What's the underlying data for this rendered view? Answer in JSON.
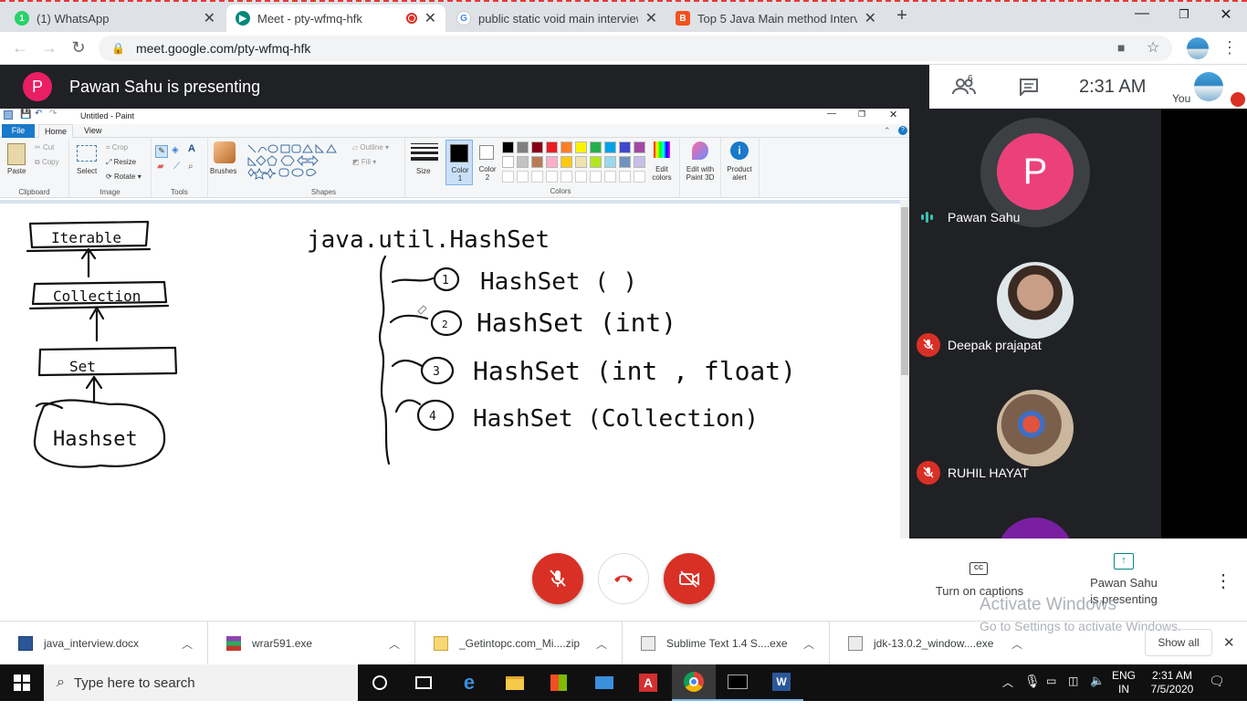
{
  "browser": {
    "tabs": [
      {
        "title": "(1) WhatsApp",
        "favicon": "whatsapp-icon",
        "color": "#25d366"
      },
      {
        "title": "Meet - pty-wfmq-hfk",
        "favicon": "meet-icon",
        "color": "#00897b"
      },
      {
        "title": "public static void main interview",
        "favicon": "google-icon",
        "color": "#4285f4"
      },
      {
        "title": "Top 5 Java Main method Intervie",
        "favicon": "blogger-icon",
        "color": "#f4511e"
      }
    ],
    "new_tab": "+",
    "url": "meet.google.com/pty-wfmq-hfk"
  },
  "meet": {
    "presenter_initial": "P",
    "presenting_banner": "Pawan Sahu is presenting",
    "participant_count": "6",
    "time": "2:31  AM",
    "you_label": "You",
    "participants": [
      {
        "name": "Pawan Sahu",
        "initial": "P",
        "avatar_color": "#ec407a",
        "speaking": true
      },
      {
        "name": "Deepak prajapat",
        "muted": true
      },
      {
        "name": "RUHIL HAYAT",
        "muted": true
      }
    ],
    "captions_label": "Turn on captions",
    "presenting_label_1": "Pawan Sahu",
    "presenting_label_2": "is presenting",
    "watermark_title": "Activate Windows",
    "watermark_sub": "Go to Settings to activate Windows."
  },
  "paint": {
    "title": "Untitled - Paint",
    "tabs": {
      "file": "File",
      "home": "Home",
      "view": "View"
    },
    "groups": {
      "clipboard": "Clipboard",
      "image": "Image",
      "tools": "Tools",
      "shapes": "Shapes",
      "colors": "Colors"
    },
    "buttons": {
      "paste": "Paste",
      "cut": "Cut",
      "copy": "Copy",
      "select": "Select",
      "crop": "Crop",
      "resize": "Resize",
      "rotate": "Rotate",
      "brushes": "Brushes",
      "outline": "Outline",
      "fill": "Fill",
      "size": "Size",
      "color1_a": "Color",
      "color1_b": "1",
      "color2_a": "Color",
      "color2_b": "2",
      "edit_colors_a": "Edit",
      "edit_colors_b": "colors",
      "paint3d_a": "Edit with",
      "paint3d_b": "Paint 3D",
      "product_a": "Product",
      "product_b": "alert"
    },
    "palette_row1": [
      "#000000",
      "#7f7f7f",
      "#880015",
      "#ed1c24",
      "#ff7f27",
      "#fff200",
      "#22b14c",
      "#00a2e8",
      "#3f48cc",
      "#a349a4"
    ],
    "palette_row2": [
      "#ffffff",
      "#c3c3c3",
      "#b97a57",
      "#ffaec9",
      "#ffc90e",
      "#efe4b0",
      "#b5e61d",
      "#99d9ea",
      "#7092be",
      "#c8bfe7"
    ],
    "drawing": {
      "hier": [
        "Iterable",
        "Collection",
        "Set",
        "Hashset"
      ],
      "heading": "java.util.HashSet",
      "constructors": [
        {
          "num": "1",
          "sig": "HashSet ( )"
        },
        {
          "num": "2",
          "sig": "HashSet (int)"
        },
        {
          "num": "3",
          "sig": "HashSet (int , float)"
        },
        {
          "num": "4",
          "sig": "HashSet (Collection)"
        }
      ]
    }
  },
  "downloads": [
    {
      "name": "java_interview.docx",
      "icon": "word-doc-icon"
    },
    {
      "name": "wrar591.exe",
      "icon": "winrar-icon"
    },
    {
      "name": "_Getintopc.com_Mi....zip",
      "icon": "zip-icon"
    },
    {
      "name": "Sublime Text 1.4 S....exe",
      "icon": "installer-icon"
    },
    {
      "name": "jdk-13.0.2_window....exe",
      "icon": "installer-icon"
    }
  ],
  "show_all": "Show all",
  "taskbar": {
    "search_placeholder": "Type here to search",
    "lang_1": "ENG",
    "lang_2": "IN",
    "time": "2:31 AM",
    "date": "7/5/2020"
  }
}
